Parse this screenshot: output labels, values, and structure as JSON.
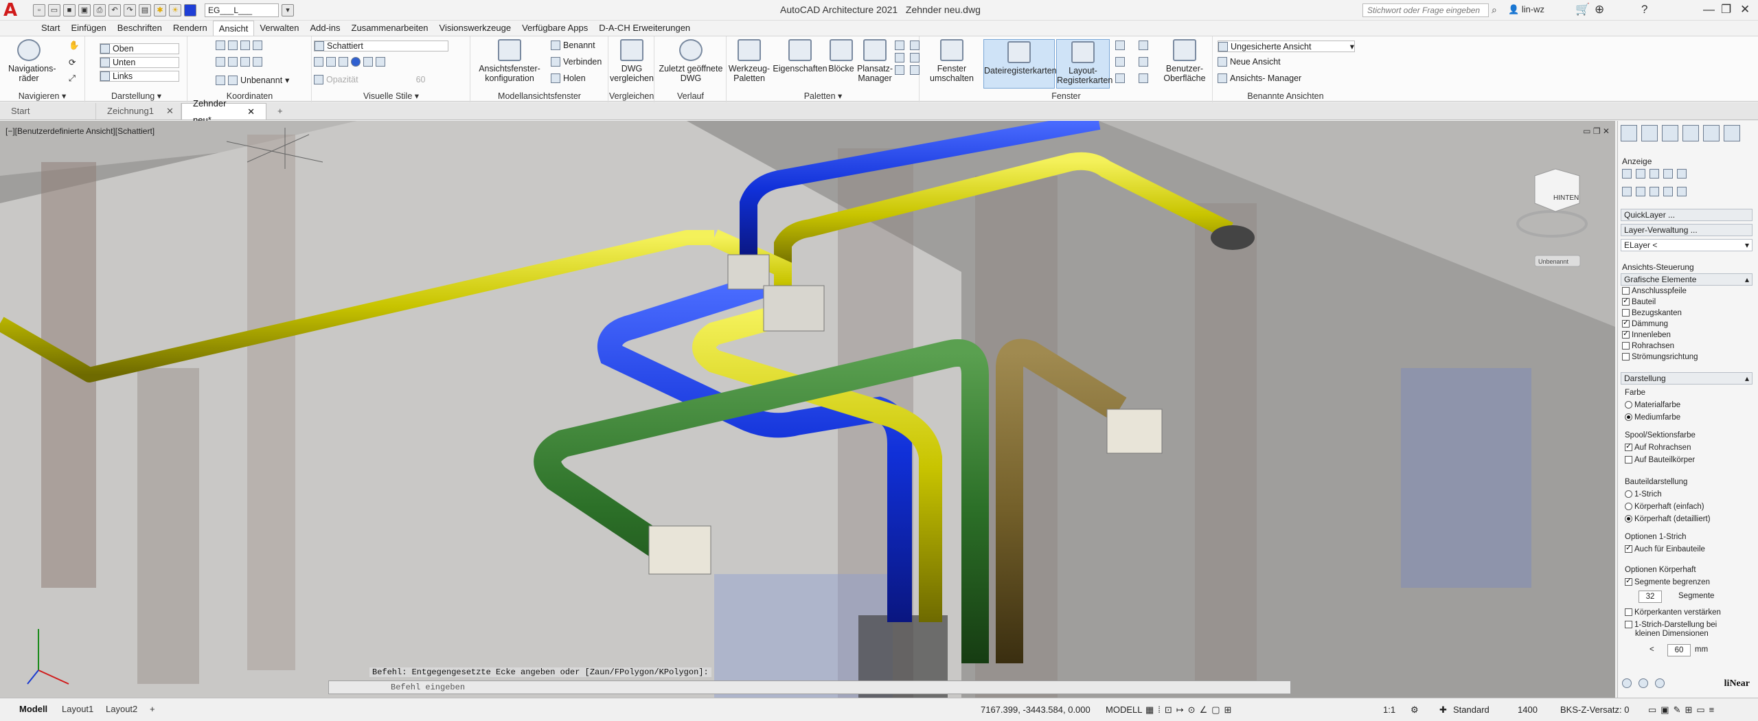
{
  "titlebar": {
    "layer_value": "EG___L___",
    "app_title": "AutoCAD Architecture 2021",
    "doc_title": "Zehnder neu.dwg",
    "search_placeholder": "Stichwort oder Frage eingeben",
    "user": "lin-wz"
  },
  "menu": [
    "Start",
    "Einfügen",
    "Beschriften",
    "Rendern",
    "Ansicht",
    "Verwalten",
    "Add-ins",
    "Zusammenarbeiten",
    "Visionswerkzeuge",
    "Verfügbare Apps",
    "D-A-CH Erweiterungen"
  ],
  "ribbon": {
    "navigieren": {
      "btn1": "Navigations-",
      "btn2": "räder",
      "title": "Navigieren"
    },
    "darstellung": {
      "oben": "Oben",
      "unten": "Unten",
      "links": "Links",
      "title": "Darstellung"
    },
    "koordinaten": {
      "unbenannt": "Unbenannt",
      "title": "Koordinaten"
    },
    "visuelle_stile": {
      "style": "Schattiert",
      "opacity_label": "Opazität",
      "opacity_value": "60",
      "title": "Visuelle Stile"
    },
    "modellansicht": {
      "btn1": "Ansichtsfenster-",
      "btn2": "konfiguration",
      "benannt": "Benannt",
      "verbinden": "Verbinden",
      "holen": "Holen",
      "title": "Modellansichtsfenster"
    },
    "vergleichen": {
      "btn1": "DWG",
      "btn2": "vergleichen",
      "title": "Vergleichen"
    },
    "verlauf": {
      "btn1": "Zuletzt geöffnete",
      "btn2": "DWG",
      "title": "Verlauf"
    },
    "paletten": {
      "werkzeug1": "Werkzeug-",
      "werkzeug2": "Paletten",
      "eigenschaften": "Eigenschaften",
      "bloecke": "Blöcke",
      "plansatz1": "Plansatz-",
      "plansatz2": "Manager",
      "title": "Paletten"
    },
    "fenster": {
      "umschalten1": "Fenster",
      "umschalten2": "umschalten",
      "dateireg": "Dateiregisterkarten",
      "layout1": "Layout-",
      "layout2": "Registerkarten",
      "title": "Fenster"
    },
    "benutzer": {
      "btn1": "Benutzer-",
      "btn2": "Oberfläche"
    },
    "benannte": {
      "ansicht": "Ungesicherte Ansicht",
      "neue": "Neue Ansicht",
      "manager": "Ansichts- Manager",
      "title": "Benannte Ansichten"
    }
  },
  "doctabs": [
    "Start",
    "Zeichnung1",
    "Zehnder neu*"
  ],
  "viewport": {
    "label": "[−][Benutzerdefinierte Ansicht][Schattiert]",
    "viewcube_face": "HINTEN",
    "unbenannt": "Unbenannt"
  },
  "command": {
    "history": "Befehl: Entgegengesetzte Ecke angeben oder [Zaun/FPolygon/KPolygon]:",
    "placeholder": "Befehl eingeben"
  },
  "rpanel": {
    "anzeige": "Anzeige",
    "quicklayer": "QuickLayer ...",
    "layerverwaltung": "Layer-Verwaltung ...",
    "elayer": "ELayer <",
    "ansichts_steuerung": "Ansichts-Steuerung",
    "grafische": "Grafische Elemente",
    "elements": [
      {
        "label": "Anschlusspfeile",
        "checked": false
      },
      {
        "label": "Bauteil",
        "checked": true
      },
      {
        "label": "Bezugskanten",
        "checked": false
      },
      {
        "label": "Dämmung",
        "checked": true
      },
      {
        "label": "Innenleben",
        "checked": true
      },
      {
        "label": "Rohrachsen",
        "checked": false
      },
      {
        "label": "Strömungsrichtung",
        "checked": false
      }
    ],
    "darstellung": "Darstellung",
    "farbe": "Farbe",
    "materialfarbe": "Materialfarbe",
    "mediumfarbe": "Mediumfarbe",
    "spool": "Spool/Sektionsfarbe",
    "auf_rohrachsen": "Auf Rohrachsen",
    "auf_bauteilkoerper": "Auf Bauteilkörper",
    "bauteildarstellung": "Bauteildarstellung",
    "einstrich": "1-Strich",
    "koerper_einfach": "Körperhaft (einfach)",
    "koerper_detail": "Körperhaft (detailliert)",
    "optionen_1strich": "Optionen 1-Strich",
    "auch_einbauteile": "Auch für Einbauteile",
    "optionen_koerper": "Optionen Körperhaft",
    "segmente_begrenzen": "Segmente begrenzen",
    "segmente_value": "32",
    "segmente": "Segmente",
    "koerperkanten": "Körperkanten verstärken",
    "einstrich_klein1": "1-Strich-Darstellung bei",
    "einstrich_klein2": "kleinen Dimensionen",
    "lt": "<",
    "mm_value": "60",
    "mm": "mm",
    "brand": "liNear"
  },
  "status": {
    "tabs": [
      "Modell",
      "Layout1",
      "Layout2"
    ],
    "coords": "7167.399, -3443.584, 0.000",
    "modell": "MODELL",
    "scale": "1:1",
    "standard": "Standard",
    "value1400": "1400",
    "bks": "BKS-Z-Versatz: 0"
  }
}
